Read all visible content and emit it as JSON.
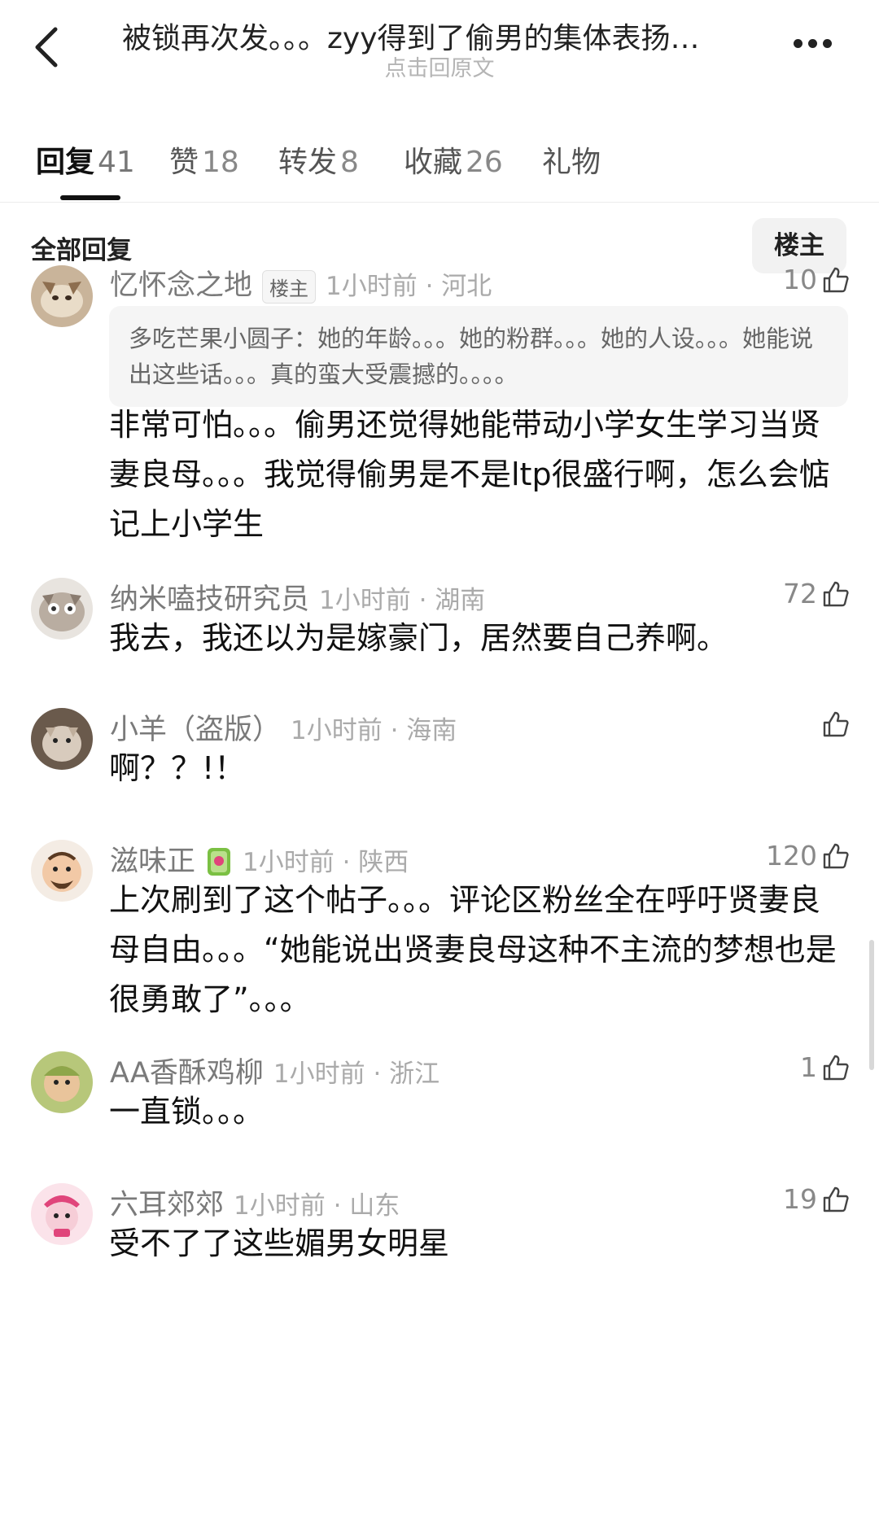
{
  "header": {
    "title": "被锁再次发。。。zyy得到了偷男的集体表扬…",
    "subtitle": "点击回原文"
  },
  "tabs": [
    {
      "label": "回复",
      "count": "41"
    },
    {
      "label": "赞",
      "count": "18"
    },
    {
      "label": "转发",
      "count": "8"
    },
    {
      "label": "收藏",
      "count": "26"
    },
    {
      "label": "礼物",
      "count": ""
    }
  ],
  "section": {
    "title": "全部回复",
    "filter_label": "楼主"
  },
  "comments": [
    {
      "name": "忆怀念之地",
      "badge": "楼主",
      "time": "1小时前 · 河北",
      "likes": "10",
      "quote": "多吃芒果小圆子：她的年龄。。。她的粉群。。。她的人设。。。她能说出这些话。。。真的蛮大受震撼的。。。。",
      "text": "非常可怕。。。偷男还觉得她能带动小学女生学习当贤妻良母。。。我觉得偷男是不是ltp很盛行啊，怎么会惦记上小学生"
    },
    {
      "name": "纳米嗑技研究员",
      "time": "1小时前 · 湖南",
      "likes": "72",
      "text": "我去，我还以为是嫁豪门，居然要自己养啊。"
    },
    {
      "name": "小羊（盗版）",
      "time": "1小时前 · 海南",
      "likes": "",
      "text": "啊？？!！"
    },
    {
      "name": "滋味正",
      "time": "1小时前 · 陕西",
      "likes": "120",
      "text": "上次刷到了这个帖子。。。评论区粉丝全在呼吁贤妻良母自由。。。“她能说出贤妻良母这种不主流的梦想也是很勇敢了”。。。"
    },
    {
      "name": "AA香酥鸡柳",
      "time": "1小时前 · 浙江",
      "likes": "1",
      "text": "一直锁。。。"
    },
    {
      "name": "六耳郊郊",
      "time": "1小时前 · 山东",
      "likes": "19",
      "text": "受不了了这些媚男女明星"
    }
  ],
  "colors": {
    "accent": "#111111",
    "muted": "#7a7a7a",
    "quote_bg": "#f5f5f5"
  },
  "icons": {
    "back": "chevron-left-icon",
    "more": "more-dots-icon",
    "like": "thumbs-up-icon",
    "medal": "medal-icon"
  }
}
